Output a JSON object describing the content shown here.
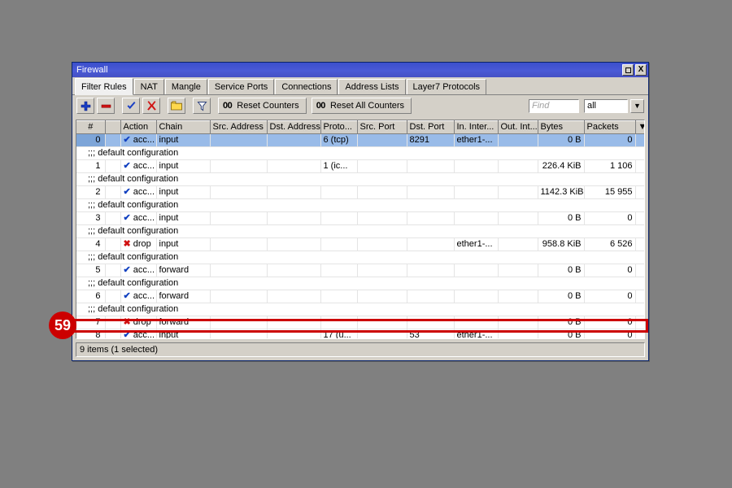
{
  "window": {
    "title": "Firewall",
    "buttons": {
      "maximize": "maximize-icon",
      "close": "X"
    }
  },
  "tabs": [
    {
      "label": "Filter Rules",
      "active": true
    },
    {
      "label": "NAT",
      "active": false
    },
    {
      "label": "Mangle",
      "active": false
    },
    {
      "label": "Service Ports",
      "active": false
    },
    {
      "label": "Connections",
      "active": false
    },
    {
      "label": "Address Lists",
      "active": false
    },
    {
      "label": "Layer7 Protocols",
      "active": false
    }
  ],
  "toolbar": {
    "add_label": "+",
    "remove_label": "-",
    "enable_label": "check",
    "disable_label": "x",
    "comment_label": "folder",
    "filter_label": "funnel",
    "reset_counters": {
      "prefix": "00",
      "label": "Reset Counters"
    },
    "reset_all_counters": {
      "prefix": "00",
      "label": "Reset All Counters"
    },
    "find_placeholder": "Find",
    "find_value": "",
    "scope_value": "all",
    "scope_arrow": "▼"
  },
  "table": {
    "columns": [
      "#",
      "",
      "Action",
      "Chain",
      "Src. Address",
      "Dst. Address",
      "Proto...",
      "Src. Port",
      "Dst. Port",
      "In. Inter...",
      "Out. Int...",
      "Bytes",
      "Packets"
    ],
    "column_menu_icon": "▼",
    "comment_text": ";;; default configuration",
    "rows": [
      {
        "kind": "data",
        "num": "0",
        "selected": true,
        "action_icon": "accept",
        "action": "acc...",
        "chain": "input",
        "src_address": "",
        "dst_address": "",
        "proto": "6 (tcp)",
        "src_port": "",
        "dst_port": "8291",
        "in_interface": "ether1-...",
        "out_interface": "",
        "bytes": "0 B",
        "packets": "0"
      },
      {
        "kind": "comment",
        "text": ";;; default configuration"
      },
      {
        "kind": "data",
        "num": "1",
        "selected": false,
        "action_icon": "accept",
        "action": "acc...",
        "chain": "input",
        "src_address": "",
        "dst_address": "",
        "proto": "1 (ic...",
        "src_port": "",
        "dst_port": "",
        "in_interface": "",
        "out_interface": "",
        "bytes": "226.4 KiB",
        "packets": "1 106"
      },
      {
        "kind": "comment",
        "text": ";;; default configuration"
      },
      {
        "kind": "data",
        "num": "2",
        "selected": false,
        "action_icon": "accept",
        "action": "acc...",
        "chain": "input",
        "src_address": "",
        "dst_address": "",
        "proto": "",
        "src_port": "",
        "dst_port": "",
        "in_interface": "",
        "out_interface": "",
        "bytes": "1142.3 KiB",
        "packets": "15 955"
      },
      {
        "kind": "comment",
        "text": ";;; default configuration"
      },
      {
        "kind": "data",
        "num": "3",
        "selected": false,
        "action_icon": "accept",
        "action": "acc...",
        "chain": "input",
        "src_address": "",
        "dst_address": "",
        "proto": "",
        "src_port": "",
        "dst_port": "",
        "in_interface": "",
        "out_interface": "",
        "bytes": "0 B",
        "packets": "0"
      },
      {
        "kind": "comment",
        "text": ";;; default configuration"
      },
      {
        "kind": "data",
        "num": "4",
        "selected": false,
        "action_icon": "drop",
        "action": "drop",
        "chain": "input",
        "src_address": "",
        "dst_address": "",
        "proto": "",
        "src_port": "",
        "dst_port": "",
        "in_interface": "ether1-...",
        "out_interface": "",
        "bytes": "958.8 KiB",
        "packets": "6 526"
      },
      {
        "kind": "comment",
        "text": ";;; default configuration"
      },
      {
        "kind": "data",
        "num": "5",
        "selected": false,
        "action_icon": "accept",
        "action": "acc...",
        "chain": "forward",
        "src_address": "",
        "dst_address": "",
        "proto": "",
        "src_port": "",
        "dst_port": "",
        "in_interface": "",
        "out_interface": "",
        "bytes": "0 B",
        "packets": "0"
      },
      {
        "kind": "comment",
        "text": ";;; default configuration"
      },
      {
        "kind": "data",
        "num": "6",
        "selected": false,
        "action_icon": "accept",
        "action": "acc...",
        "chain": "forward",
        "src_address": "",
        "dst_address": "",
        "proto": "",
        "src_port": "",
        "dst_port": "",
        "in_interface": "",
        "out_interface": "",
        "bytes": "0 B",
        "packets": "0"
      },
      {
        "kind": "comment",
        "text": ";;; default configuration"
      },
      {
        "kind": "data",
        "num": "7",
        "selected": false,
        "action_icon": "drop",
        "action": "drop",
        "chain": "forward",
        "src_address": "",
        "dst_address": "",
        "proto": "",
        "src_port": "",
        "dst_port": "",
        "in_interface": "",
        "out_interface": "",
        "bytes": "0 B",
        "packets": "0"
      },
      {
        "kind": "data",
        "num": "8",
        "selected": false,
        "highlighted": true,
        "action_icon": "accept",
        "action": "acc...",
        "chain": "input",
        "src_address": "",
        "dst_address": "",
        "proto": "17 (u...",
        "src_port": "",
        "dst_port": "53",
        "in_interface": "ether1-...",
        "out_interface": "",
        "bytes": "0 B",
        "packets": "0"
      }
    ]
  },
  "statusbar": {
    "text": "9 items (1 selected)"
  },
  "annotation": {
    "badge_number": "59",
    "accent_color": "#cc0000"
  }
}
